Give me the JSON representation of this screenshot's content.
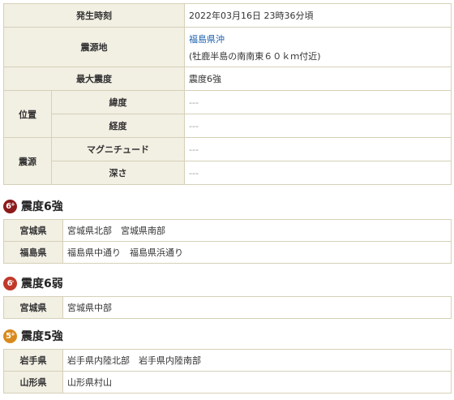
{
  "info": {
    "occurrence_label": "発生時刻",
    "occurrence_value": "2022年03月16日 23時36分頃",
    "epicenter_label": "震源地",
    "epicenter_value": "福島県沖",
    "epicenter_detail": "(牡鹿半島の南南東６０ｋｍ付近)",
    "max_intensity_label": "最大震度",
    "max_intensity_value": "震度6強",
    "position_label": "位置",
    "latitude_label": "緯度",
    "latitude_value": "---",
    "longitude_label": "経度",
    "longitude_value": "---",
    "source_label": "震源",
    "magnitude_label": "マグニチュード",
    "magnitude_value": "---",
    "depth_label": "深さ",
    "depth_value": "---"
  },
  "sections": [
    {
      "title": "震度6強",
      "badge": "6",
      "badge_sign": "+",
      "badge_color": "#8b1a1a",
      "rows": [
        {
          "pref": "宮城県",
          "areas": "宮城県北部　宮城県南部"
        },
        {
          "pref": "福島県",
          "areas": "福島県中通り　福島県浜通り"
        }
      ]
    },
    {
      "title": "震度6弱",
      "badge": "6",
      "badge_sign": "-",
      "badge_color": "#c0392b",
      "rows": [
        {
          "pref": "宮城県",
          "areas": "宮城県中部"
        }
      ]
    },
    {
      "title": "震度5強",
      "badge": "5",
      "badge_sign": "+",
      "badge_color": "#d98a1e",
      "rows": [
        {
          "pref": "岩手県",
          "areas": "岩手県内陸北部　岩手県内陸南部"
        },
        {
          "pref": "山形県",
          "areas": "山形県村山"
        }
      ]
    }
  ]
}
